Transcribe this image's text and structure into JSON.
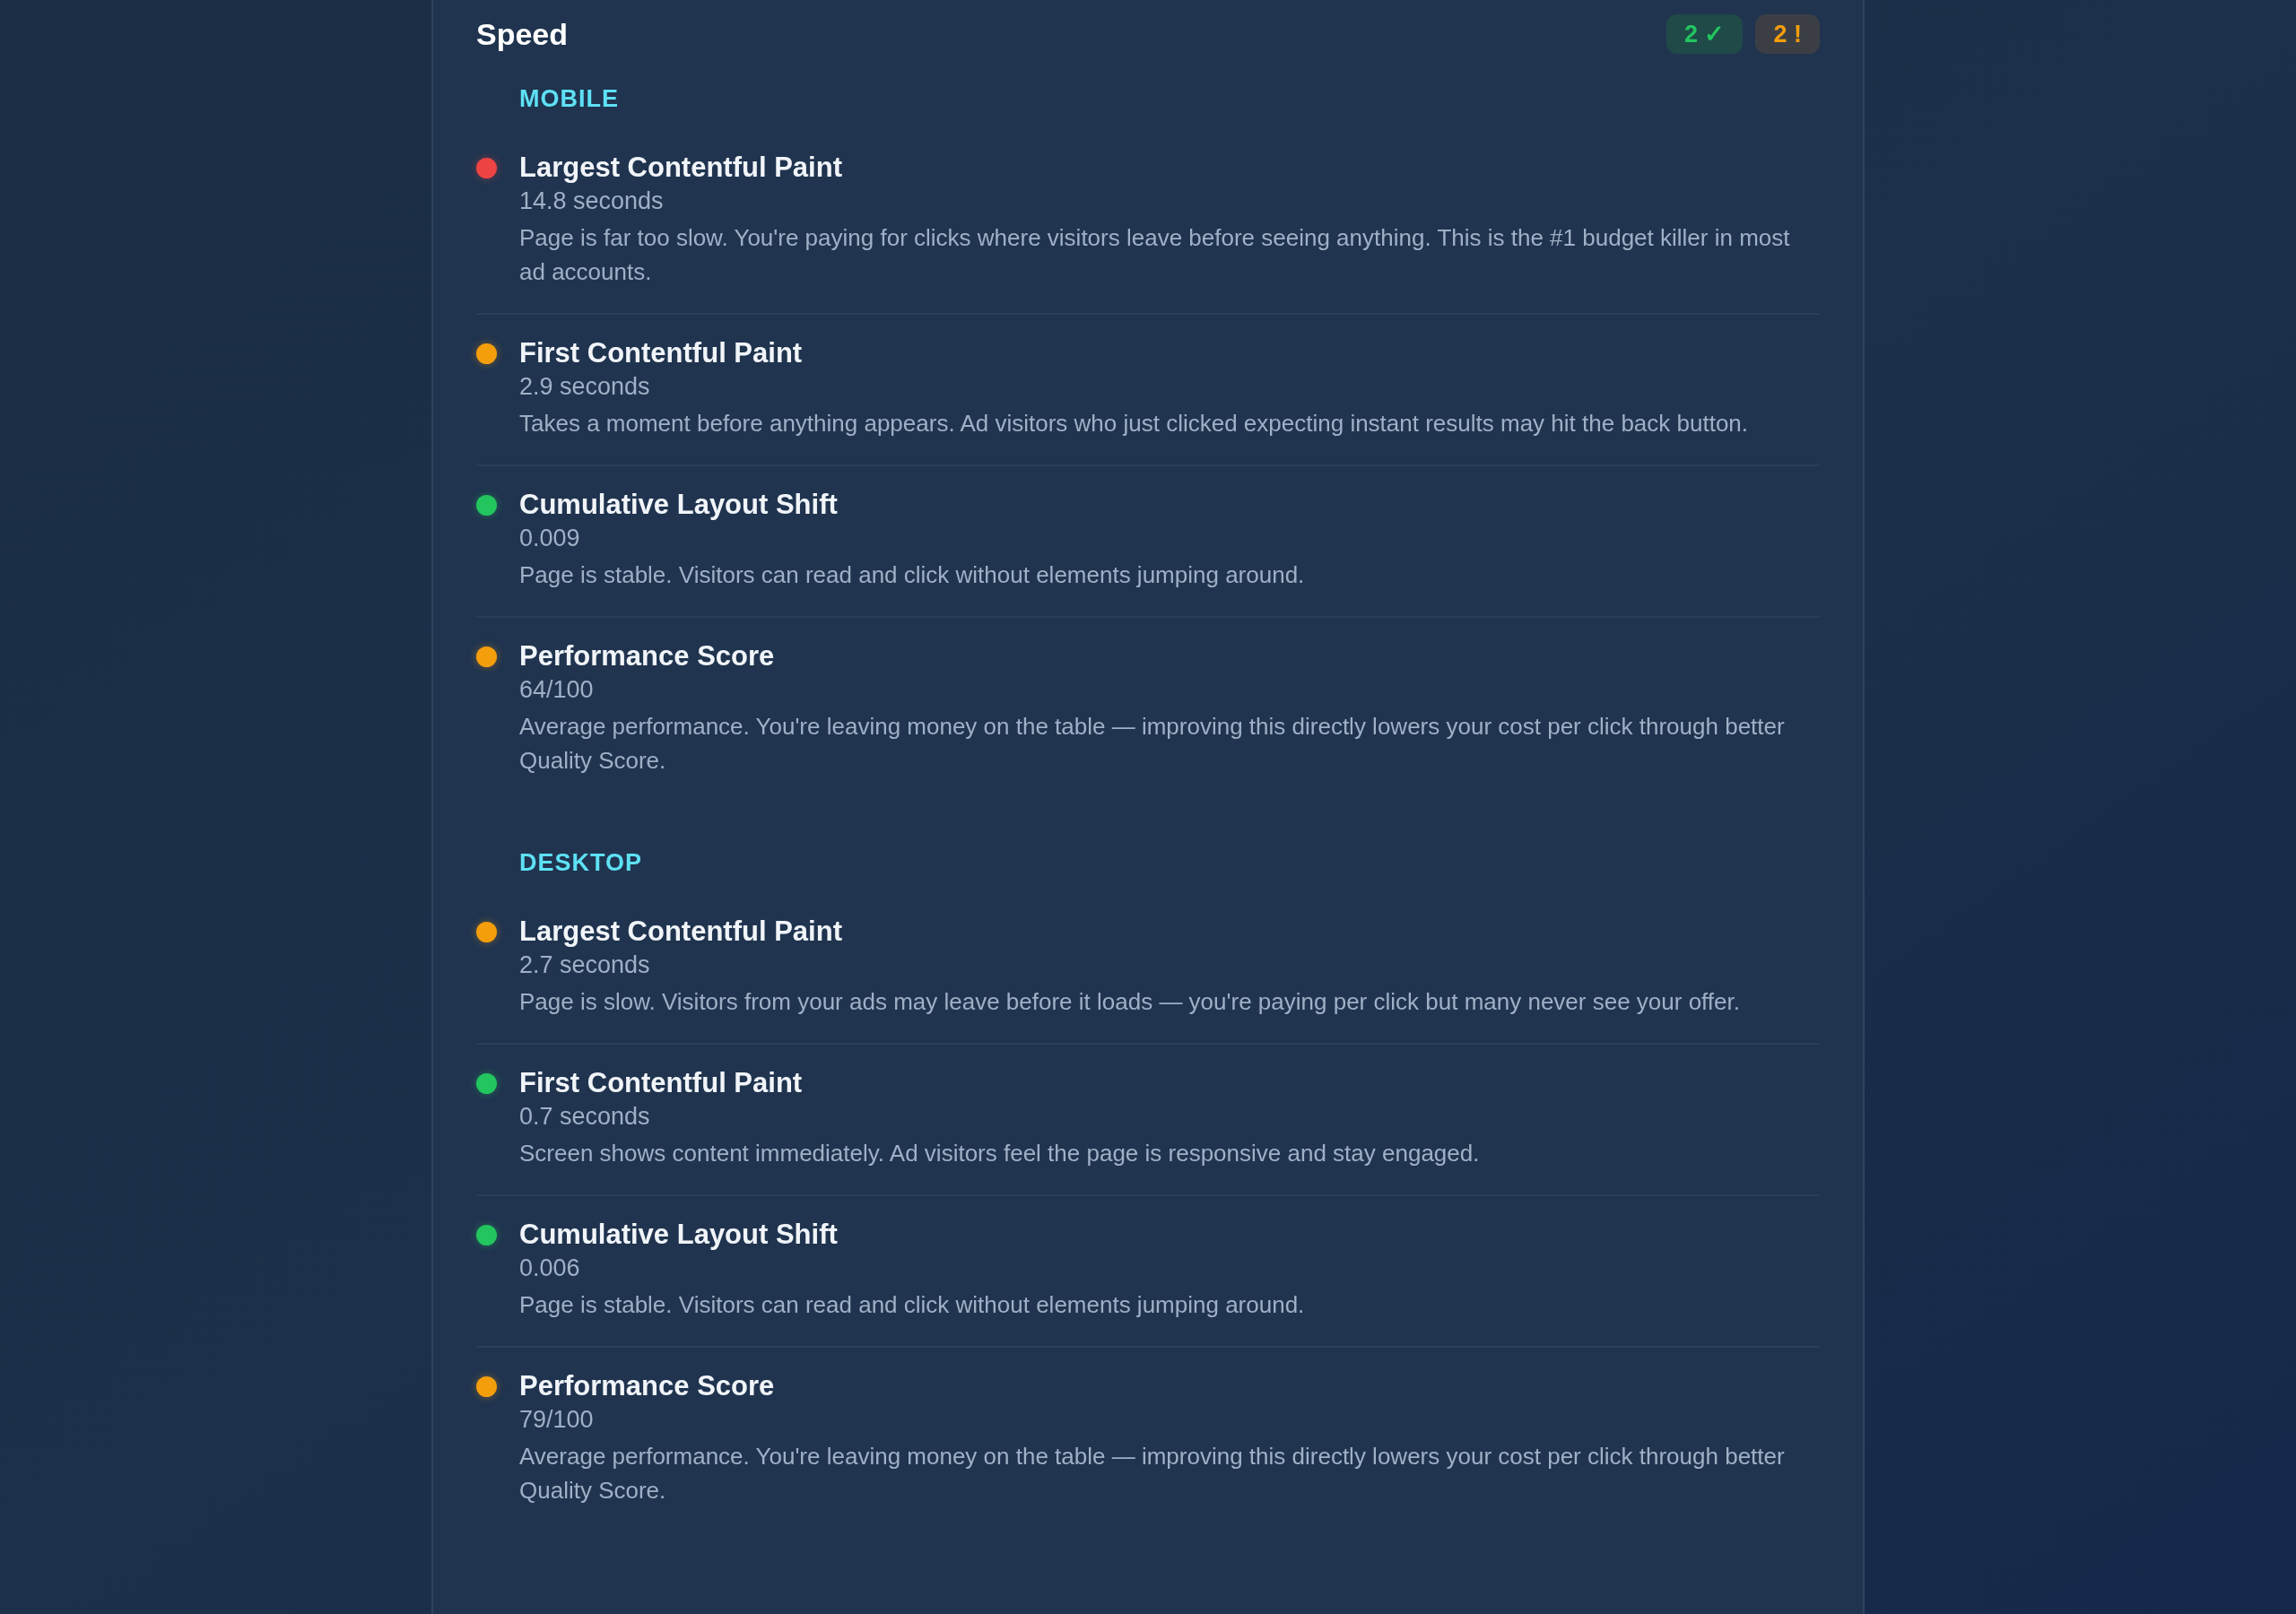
{
  "panel": {
    "title": "Speed",
    "badges": [
      {
        "kind": "pass",
        "label": "2 ✓"
      },
      {
        "kind": "warn",
        "label": "2 !"
      }
    ]
  },
  "sections": [
    {
      "label": "MOBILE",
      "metrics": [
        {
          "name": "Largest Contentful Paint",
          "value": "14.8 seconds",
          "color": "#ef4444",
          "description": "Page is far too slow. You're paying for clicks where visitors leave before seeing anything. This is the #1 budget killer in most ad accounts."
        },
        {
          "name": "First Contentful Paint",
          "value": "2.9 seconds",
          "color": "#f59e0b",
          "description": "Takes a moment before anything appears. Ad visitors who just clicked expecting instant results may hit the back button."
        },
        {
          "name": "Cumulative Layout Shift",
          "value": "0.009",
          "color": "#22c55e",
          "description": "Page is stable. Visitors can read and click without elements jumping around."
        },
        {
          "name": "Performance Score",
          "value": "64/100",
          "color": "#f59e0b",
          "description": "Average performance. You're leaving money on the table — improving this directly lowers your cost per click through better Quality Score."
        }
      ]
    },
    {
      "label": "DESKTOP",
      "metrics": [
        {
          "name": "Largest Contentful Paint",
          "value": "2.7 seconds",
          "color": "#f59e0b",
          "description": "Page is slow. Visitors from your ads may leave before it loads — you're paying per click but many never see your offer."
        },
        {
          "name": "First Contentful Paint",
          "value": "0.7 seconds",
          "color": "#22c55e",
          "description": "Screen shows content immediately. Ad visitors feel the page is responsive and stay engaged."
        },
        {
          "name": "Cumulative Layout Shift",
          "value": "0.006",
          "color": "#22c55e",
          "description": "Page is stable. Visitors can read and click without elements jumping around."
        },
        {
          "name": "Performance Score",
          "value": "79/100",
          "color": "#f59e0b",
          "description": "Average performance. You're leaving money on the table — improving this directly lowers your cost per click through better Quality Score."
        }
      ]
    }
  ]
}
